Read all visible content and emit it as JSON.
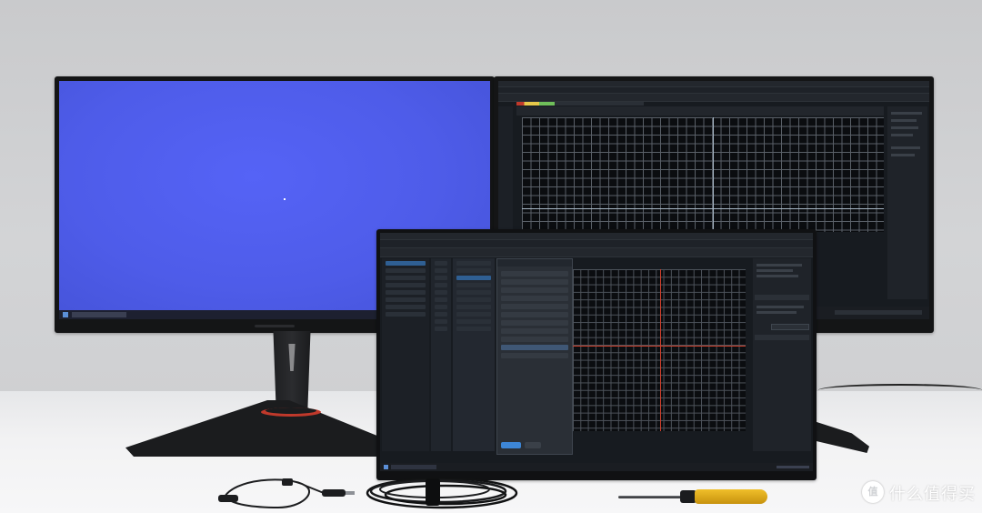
{
  "scene": {
    "watermark_text": "什么值得买",
    "watermark_icon": "zhi-logo-icon"
  },
  "laptop_dialog": {
    "ok_label": "",
    "cancel_label": ""
  },
  "colors": {
    "desktop_blue": "#4e5ce9",
    "dark_ui": "#171b20",
    "grid_line": "#5a6068",
    "crosshair_red": "#d0402c",
    "accent_blue": "#3d86d6",
    "screwdriver_handle": "#d9a514"
  }
}
